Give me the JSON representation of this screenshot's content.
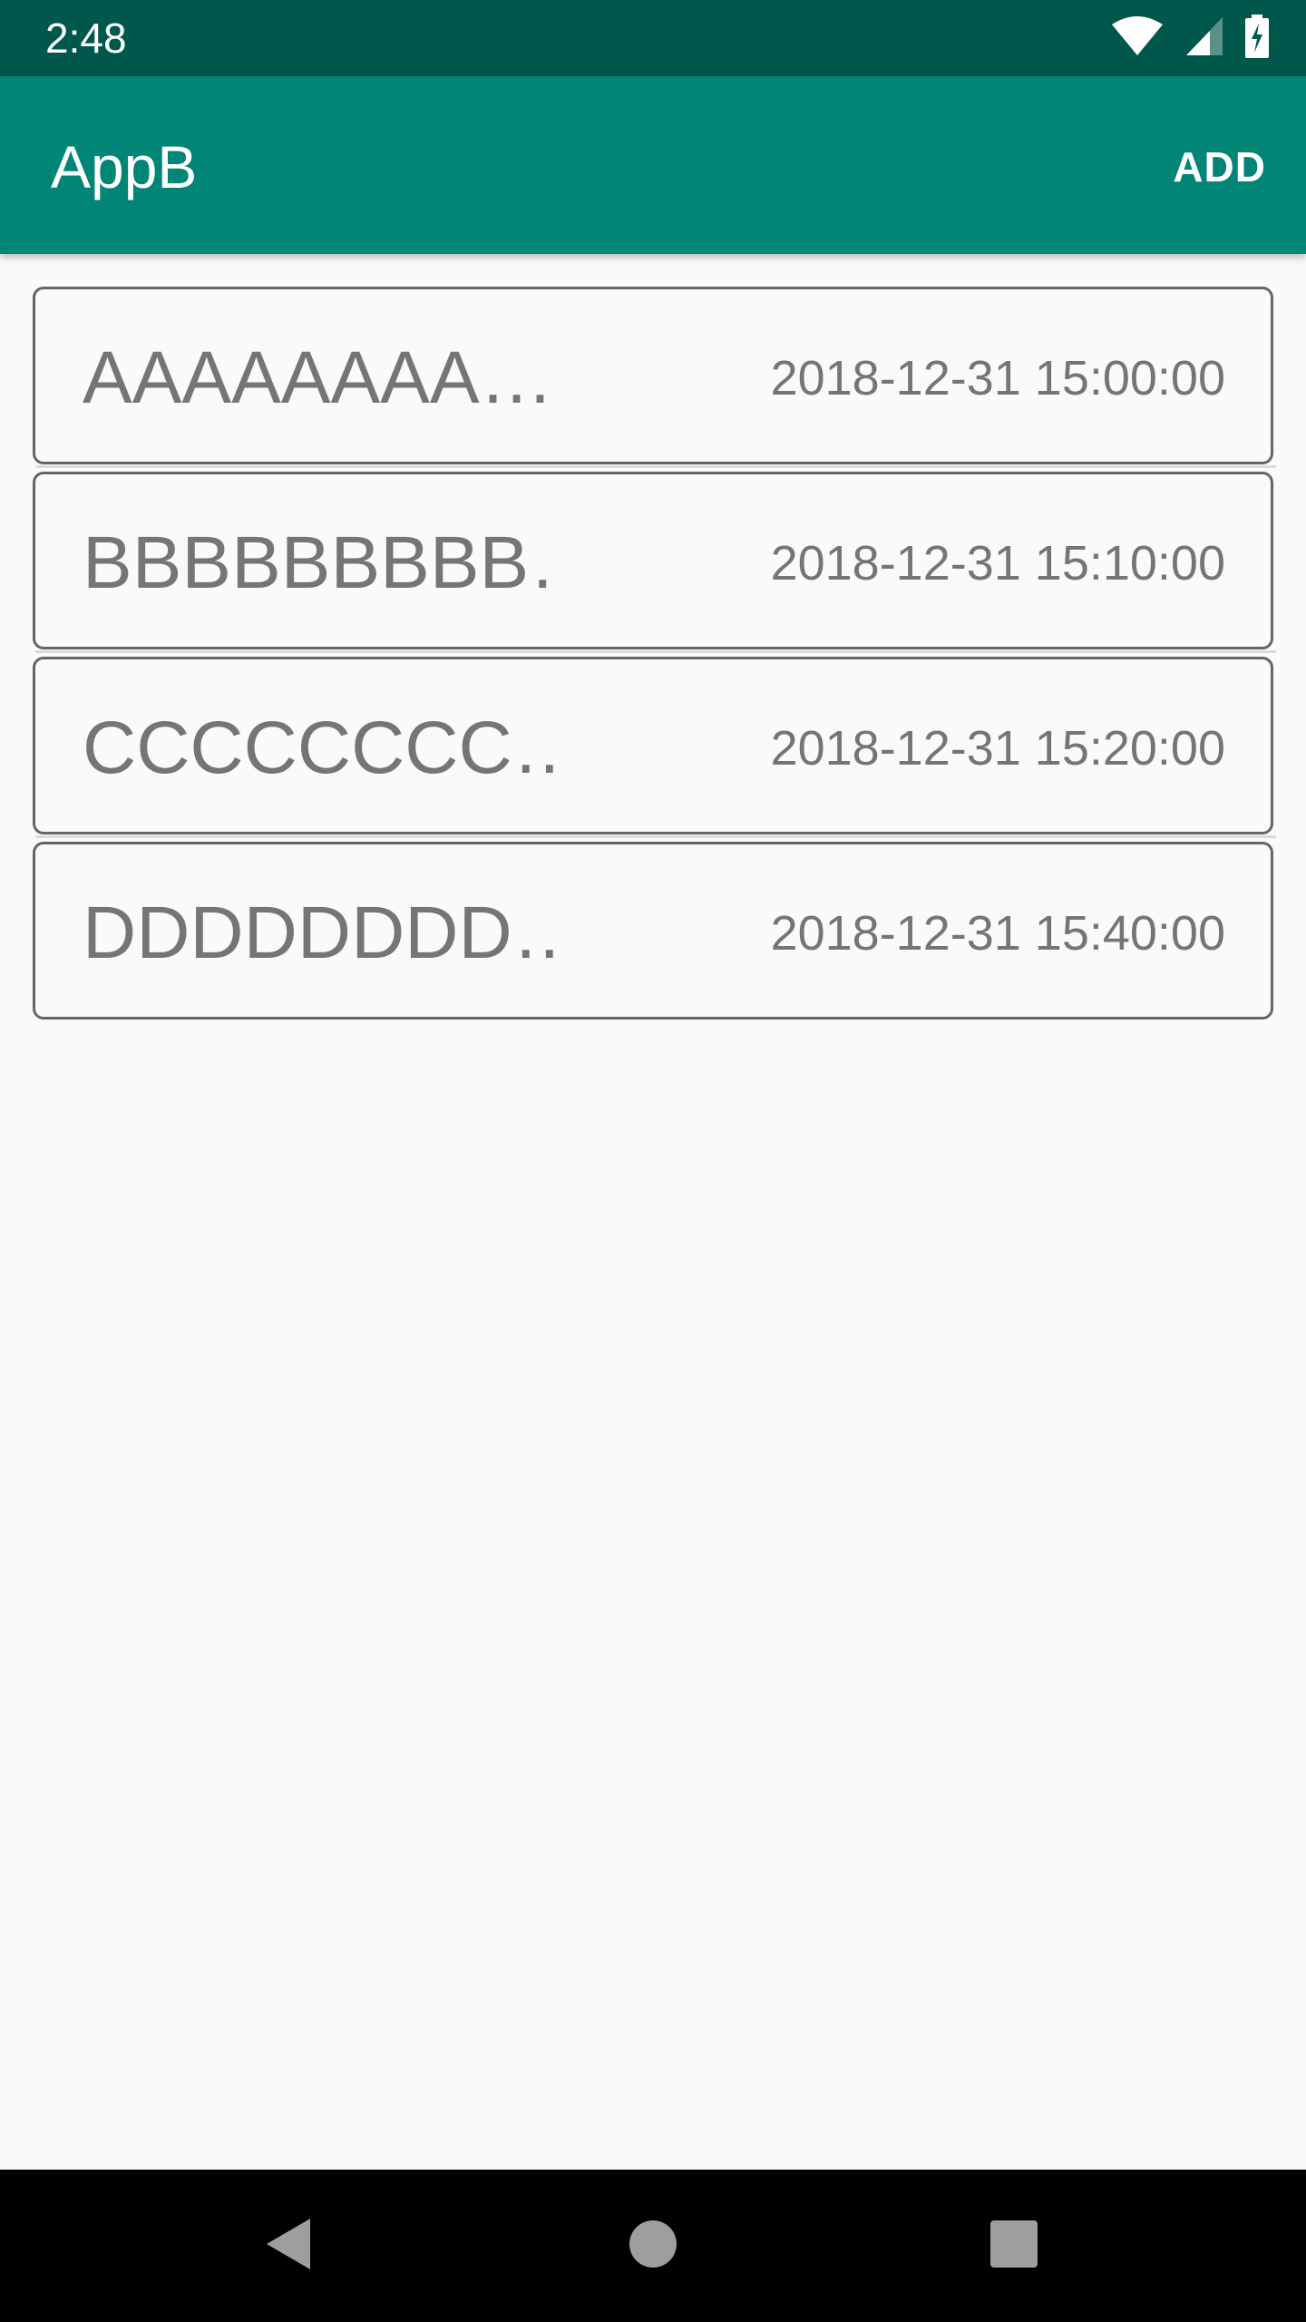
{
  "status_bar": {
    "time": "2:48",
    "icons": [
      "wifi-icon",
      "cellular-signal-icon",
      "battery-charging-icon"
    ]
  },
  "app_bar": {
    "title": "AppB",
    "action_label": "ADD"
  },
  "list": {
    "items": [
      {
        "title": "AAAAAAAA…",
        "time": "2018-12-31 15:00:00"
      },
      {
        "title": "BBBBBBBBB…",
        "time": "2018-12-31 15:10:00"
      },
      {
        "title": "CCCCCCCC…",
        "time": "2018-12-31 15:20:00"
      },
      {
        "title": "DDDDDDDD…",
        "time": "2018-12-31 15:40:00"
      }
    ]
  },
  "nav_bar": {
    "icons": [
      "back-icon",
      "home-icon",
      "recents-icon"
    ]
  },
  "colors": {
    "status_bar": "#00574b",
    "app_bar": "#008577",
    "background": "#fafafa",
    "item_text": "#757575",
    "item_border": "#666666"
  }
}
